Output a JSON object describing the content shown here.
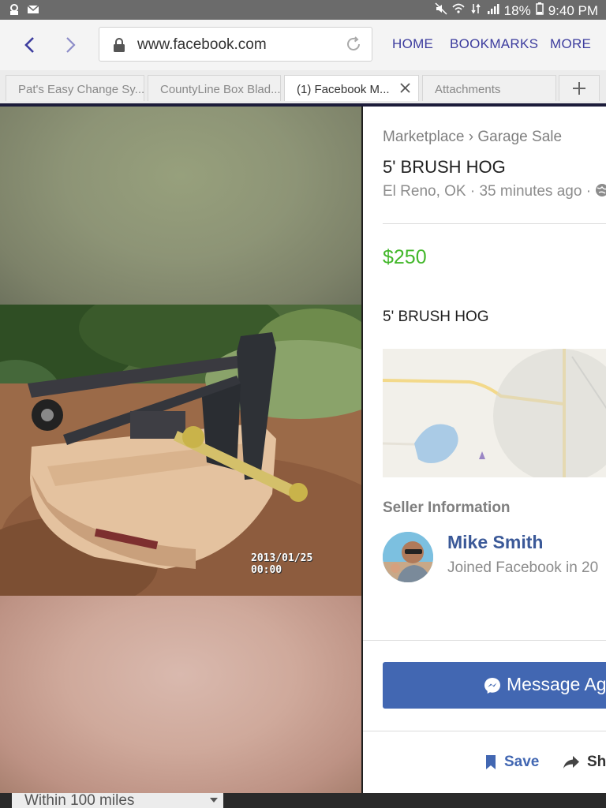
{
  "status": {
    "battery": "18%",
    "time": "9:40 PM"
  },
  "browser": {
    "url": "www.facebook.com",
    "nav_links": [
      "HOME",
      "BOOKMARKS",
      "MORE"
    ],
    "tabs": [
      {
        "label": "Pat's Easy Change Sy..."
      },
      {
        "label": "CountyLine Box Blad..."
      },
      {
        "label": "(1) Facebook M..."
      },
      {
        "label": "Attachments"
      }
    ]
  },
  "photo": {
    "stamp_date": "2013/01/25",
    "stamp_time": "00:00"
  },
  "listing": {
    "breadcrumb": "Marketplace › Garage Sale",
    "title": "5' BRUSH HOG",
    "meta": "El Reno, OK · 35 minutes ago ·",
    "price": "$250",
    "description": "5' BRUSH HOG"
  },
  "seller": {
    "heading": "Seller Information",
    "name": "Mike Smith",
    "joined": "Joined Facebook in 20"
  },
  "actions": {
    "message": "Message Ag",
    "save": "Save",
    "share": "Sh"
  },
  "bottom": {
    "filter": "Within 100 miles"
  },
  "colors": {
    "price": "#42b72a",
    "brand": "#4267b2",
    "nav": "#3c3c9e"
  }
}
